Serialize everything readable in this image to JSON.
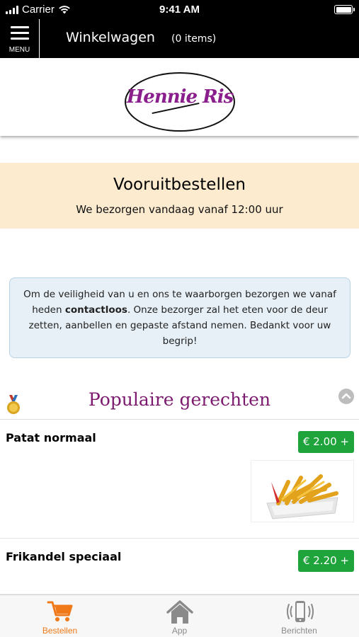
{
  "status_bar": {
    "carrier": "Carrier",
    "time": "9:41 AM"
  },
  "header": {
    "menu_label": "MENU",
    "title": "Winkelwagen",
    "item_count": "(0 items)"
  },
  "logo": {
    "text": "Hennie Ris"
  },
  "banner": {
    "title": "Vooruitbestellen",
    "subtitle": "We bezorgen vandaag vanaf 12:00 uur"
  },
  "notice": {
    "part1": "Om de veiligheid van u en ons te waarborgen bezorgen we vanaf heden ",
    "bold": "contactloos",
    "part2": ". Onze bezorger zal het eten voor de deur zetten, aanbellen en gepaste afstand nemen. Bedankt voor uw begrip!"
  },
  "section": {
    "title": "Populaire gerechten"
  },
  "items": [
    {
      "name": "Patat normaal",
      "price": "€ 2.00 +"
    },
    {
      "name": "Frikandel speciaal",
      "price": "€ 2.20 +"
    }
  ],
  "tabs": [
    {
      "label": "Bestellen",
      "icon": "cart-icon",
      "color": "#f07a1a"
    },
    {
      "label": "App",
      "icon": "home-icon",
      "color": "#8a8a8a"
    },
    {
      "label": "Berichten",
      "icon": "phone-vibrate-icon",
      "color": "#8a8a8a"
    }
  ],
  "colors": {
    "accent": "#f07a1a",
    "price": "#1ea43b",
    "section_title": "#7b1a6e",
    "banner_bg": "#fdebd0",
    "notice_bg": "#e7f0f7"
  }
}
